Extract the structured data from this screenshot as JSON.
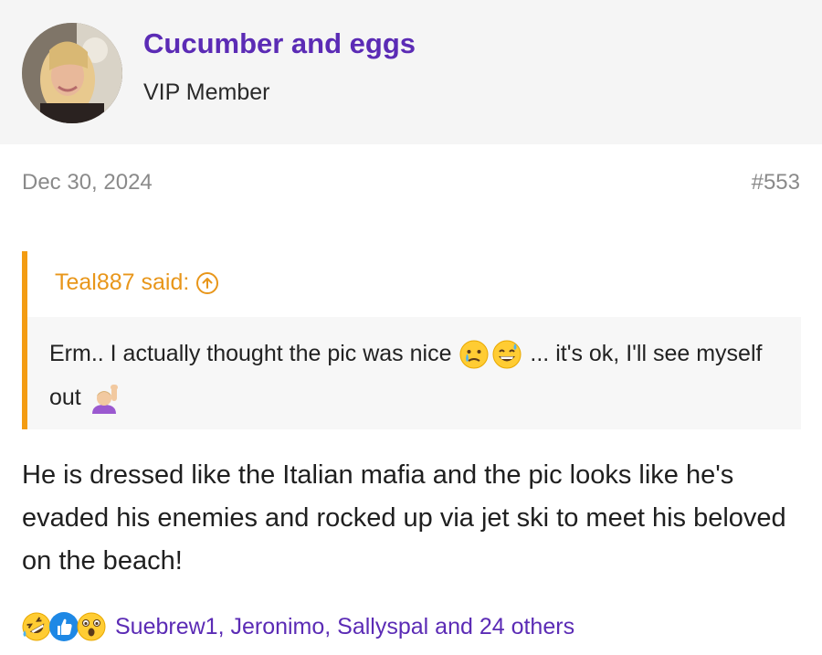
{
  "author": {
    "name": "Cucumber and eggs",
    "title": "VIP Member"
  },
  "post": {
    "date": "Dec 30, 2024",
    "number": "#553"
  },
  "quote": {
    "author_label": "Teal887 said:",
    "text_part1": "Erm.. I actually thought the pic was nice",
    "text_part2": "... it's ok, I'll see myself out",
    "emojis": [
      "crying-face-emoji",
      "grinning-sweat-emoji",
      "person-raising-hand-emoji"
    ]
  },
  "message": {
    "text": "He is dressed like the Italian mafia and the pic looks like he's evaded his enemies and rocked up via jet ski to meet his beloved on the beach!"
  },
  "reactions": {
    "icons": [
      "rofl-icon",
      "like-icon",
      "wow-icon"
    ],
    "users_text": "Suebrew1, Jeronimo, Sallyspal and 24 others"
  },
  "colors": {
    "username": "#5b2bb5",
    "quote_accent": "#f39c12",
    "meta_gray": "#8a8a8a"
  }
}
